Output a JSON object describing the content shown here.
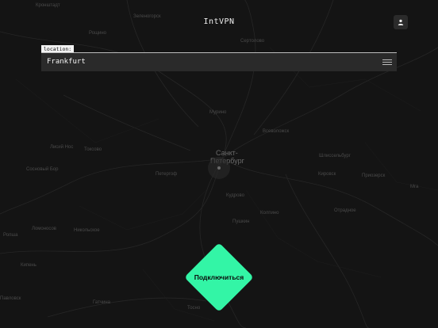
{
  "app": {
    "title": "IntVPN"
  },
  "location": {
    "label": "location:",
    "value": "Frankfurt"
  },
  "connect": {
    "label": "Подключиться"
  },
  "map": {
    "city_main_line1": "Санкт-",
    "city_main_line2": "Петербург",
    "labels": [
      "Кронштадт",
      "Колпино",
      "Пушкин",
      "Всеволожск",
      "Петергоф",
      "Кировск",
      "Шлиссельбург",
      "Сосновый Бор",
      "Ломоносов",
      "Павловск",
      "Гатчина",
      "Мга",
      "Отрадное",
      "Никольское",
      "Приозерск",
      "Рощино",
      "Зеленогорск",
      "Сертолово",
      "Токсово",
      "Кудрово",
      "Мурино",
      "Лисий Нос",
      "Тосно",
      "Кипень",
      "Ропша"
    ]
  },
  "colors": {
    "accent": "#33f5a6",
    "background": "#141414",
    "panel": "#2a2a2a"
  },
  "icons": {
    "profile": "user-icon",
    "menu": "hamburger-menu-icon"
  }
}
